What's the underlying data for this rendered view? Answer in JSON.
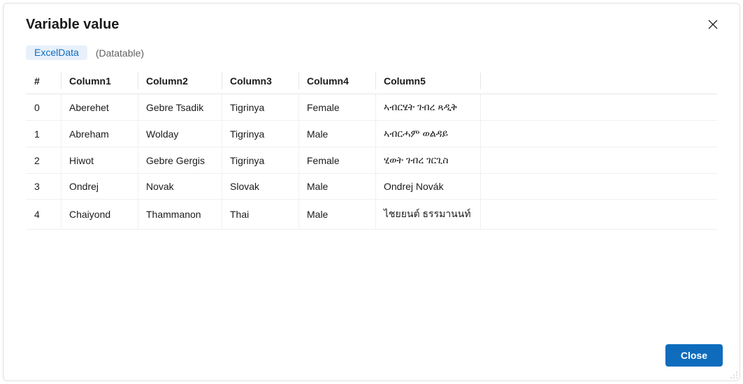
{
  "dialog": {
    "title": "Variable value",
    "variable_name": "ExcelData",
    "variable_type": "(Datatable)",
    "close_label": "Close"
  },
  "table": {
    "headers": {
      "index": "#",
      "c1": "Column1",
      "c2": "Column2",
      "c3": "Column3",
      "c4": "Column4",
      "c5": "Column5"
    },
    "rows": [
      {
        "index": "0",
        "c1": "Aberehet",
        "c2": "Gebre Tsadik",
        "c3": "Tigrinya",
        "c4": "Female",
        "c5": "ኣብርሄት ገብረ ጻዲቅ"
      },
      {
        "index": "1",
        "c1": "Abreham",
        "c2": "Wolday",
        "c3": "Tigrinya",
        "c4": "Male",
        "c5": "ኣብርሓም ወልዳይ"
      },
      {
        "index": "2",
        "c1": "Hiwot",
        "c2": "Gebre Gergis",
        "c3": "Tigrinya",
        "c4": "Female",
        "c5": "ሂወት ገብረ ገርጊስ"
      },
      {
        "index": "3",
        "c1": "Ondrej",
        "c2": "Novak",
        "c3": "Slovak",
        "c4": "Male",
        "c5": "Ondrej Novák"
      },
      {
        "index": "4",
        "c1": "Chaiyond",
        "c2": "Thammanon",
        "c3": "Thai",
        "c4": "Male",
        "c5": "ไชยยนต์ ธรรมานนท์"
      }
    ]
  }
}
